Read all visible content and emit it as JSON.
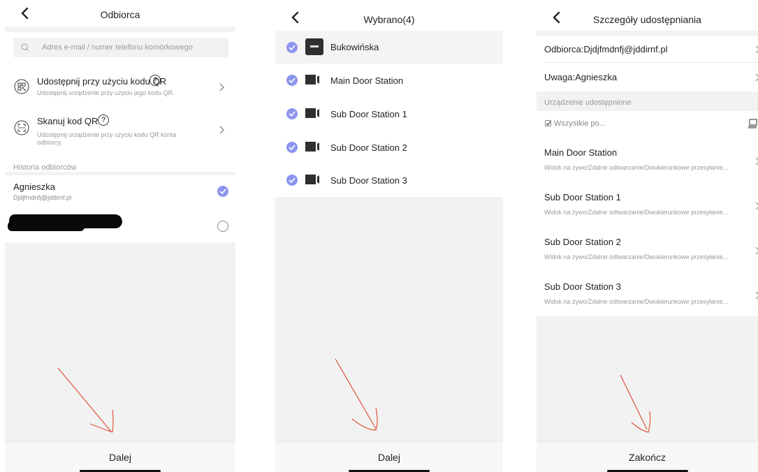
{
  "colors": {
    "accent": "#8c95ee",
    "arrow": "#e0533b"
  },
  "panel1": {
    "title": "Odbiorca",
    "search_placeholder": "Adres e-mail / numer telefonu komórkowego",
    "qr_share": {
      "title": "Udostępnij przy użyciu kodu QR",
      "help": "?",
      "desc": "Udostępnij urządzenie przy użyciu jego kodu QR."
    },
    "qr_scan": {
      "title": "Skanuj kod QR",
      "help": "?",
      "desc_line1": "Udostępnij urządzenie przy użyciu kodu QR konta",
      "desc_line2": "odbiorcy."
    },
    "history_header": "Historia odbiorców",
    "recipients": [
      {
        "name": "Agnieszka",
        "email": "Djdjfmdnfj@jddirnf.pl",
        "selected": true
      },
      {
        "name": "",
        "email": "",
        "selected": false,
        "redacted": true
      }
    ],
    "footer_label": "Dalej"
  },
  "panel2": {
    "title": "Wybrano(4)",
    "items": [
      {
        "label": "Bukowińska",
        "icon": "nvr-device-icon",
        "checked": true
      },
      {
        "label": "Main Door Station",
        "icon": "camera-icon",
        "checked": true
      },
      {
        "label": "Sub Door Station 1",
        "icon": "camera-icon",
        "checked": true
      },
      {
        "label": "Sub Door Station 2",
        "icon": "camera-icon",
        "checked": true
      },
      {
        "label": "Sub Door Station 3",
        "icon": "camera-icon",
        "checked": true
      }
    ],
    "footer_label": "Dalej"
  },
  "panel3": {
    "title": "Szczegóły udostępniania",
    "recipient": "Odbiorca:Djdjfmdnfj@jddirnf.pl",
    "note": "Uwaga:Agnieszka",
    "shared_header": "Urządzenie udostępnione",
    "select_all": "Wszystkie po...",
    "devices": [
      {
        "name": "Main Door Station",
        "permissions": "Widok na żywo/Zdalne odtwarzanie/Dwukierunkowe przesyłanie..."
      },
      {
        "name": "Sub Door Station 1",
        "permissions": "Widok na żywo/Zdalne odtwarzanie/Dwukierunkowe przesyłanie..."
      },
      {
        "name": "Sub Door Station 2",
        "permissions": "Widok na żywo/Zdalne odtwarzanie/Dwukierunkowe przesyłanie..."
      },
      {
        "name": "Sub Door Station 3",
        "permissions": "Widok na żywo/Zdalne odtwarzanie/Dwukierunkowe przesyłanie..."
      }
    ],
    "footer_label": "Zakończ"
  }
}
